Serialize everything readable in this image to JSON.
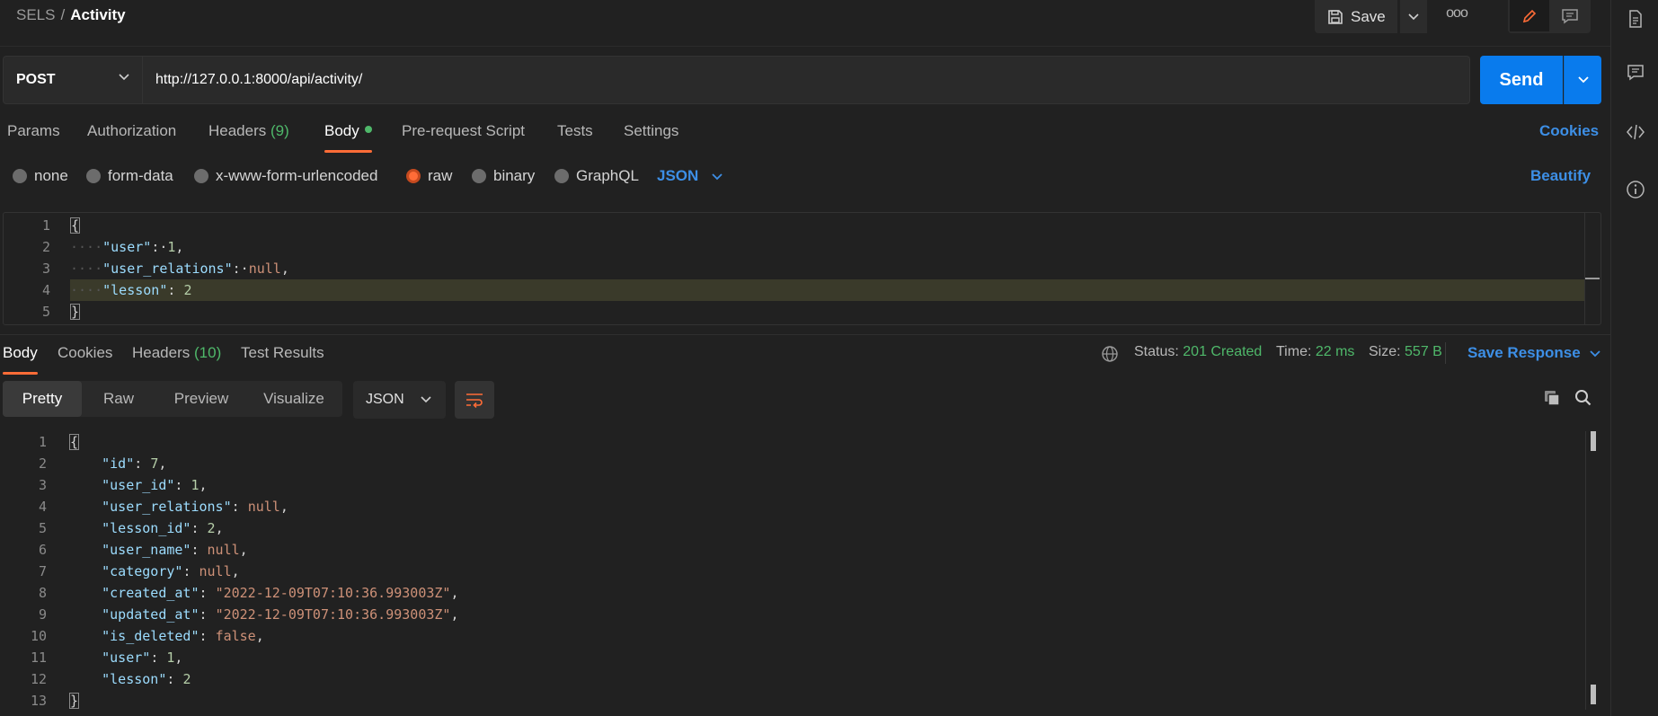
{
  "breadcrumb": {
    "collection": "SELS",
    "separator": "/",
    "request": "Activity"
  },
  "header": {
    "save_label": "Save",
    "more_label": "ooo"
  },
  "request": {
    "method": "POST",
    "url": "http://127.0.0.1:8000/api/activity/",
    "send_label": "Send"
  },
  "request_tabs": {
    "params": "Params",
    "authorization": "Authorization",
    "headers": "Headers",
    "headers_count": "(9)",
    "body": "Body",
    "prerequest": "Pre-request Script",
    "tests": "Tests",
    "settings": "Settings",
    "cookies": "Cookies"
  },
  "body_types": {
    "none": "none",
    "form_data": "form-data",
    "urlencoded": "x-www-form-urlencoded",
    "raw": "raw",
    "binary": "binary",
    "graphql": "GraphQL",
    "language": "JSON",
    "beautify": "Beautify",
    "selected": "raw"
  },
  "request_body": {
    "line_numbers": [
      "1",
      "2",
      "3",
      "4",
      "5"
    ],
    "l1": "{",
    "l2_key": "\"user\"",
    "l2_val": "1",
    "l3_key": "\"user_relations\"",
    "l3_val": "null",
    "l4_key": "\"lesson\"",
    "l4_val": "2",
    "l5": "}"
  },
  "response_tabs": {
    "body": "Body",
    "cookies": "Cookies",
    "headers": "Headers",
    "headers_count": "(10)",
    "test_results": "Test Results"
  },
  "response_status": {
    "status_label": "Status:",
    "status_value": "201 Created",
    "time_label": "Time:",
    "time_value": "22 ms",
    "size_label": "Size:",
    "size_value": "557 B",
    "save_response": "Save Response"
  },
  "response_view": {
    "pretty": "Pretty",
    "raw": "Raw",
    "preview": "Preview",
    "visualize": "Visualize",
    "format": "JSON"
  },
  "response_body": {
    "line_numbers": [
      "1",
      "2",
      "3",
      "4",
      "5",
      "6",
      "7",
      "8",
      "9",
      "10",
      "11",
      "12",
      "13"
    ],
    "l1": "{",
    "l2_key": "\"id\"",
    "l2_val": "7",
    "l3_key": "\"user_id\"",
    "l3_val": "1",
    "l4_key": "\"user_relations\"",
    "l4_val": "null",
    "l5_key": "\"lesson_id\"",
    "l5_val": "2",
    "l6_key": "\"user_name\"",
    "l6_val": "null",
    "l7_key": "\"category\"",
    "l7_val": "null",
    "l8_key": "\"created_at\"",
    "l8_val": "\"2022-12-09T07:10:36.993003Z\"",
    "l9_key": "\"updated_at\"",
    "l9_val": "\"2022-12-09T07:10:36.993003Z\"",
    "l10_key": "\"is_deleted\"",
    "l10_val": "false",
    "l11_key": "\"user\"",
    "l11_val": "1",
    "l12_key": "\"lesson\"",
    "l12_val": "2",
    "l13": "}"
  },
  "colors": {
    "accent_orange": "#ff6c37",
    "send_blue": "#097bed",
    "link_blue": "#3d8fe6",
    "success_green": "#4fb86a",
    "background": "#212121"
  },
  "icons": {
    "save": "floppy-disk-icon",
    "caret": "chevron-down-icon",
    "edit": "pencil-icon",
    "comment": "comment-icon",
    "globe": "globe-icon",
    "wrap": "wrap-lines-icon",
    "copy": "copy-icon",
    "search": "search-icon",
    "docs": "document-icon",
    "code": "code-icon",
    "info": "info-icon"
  }
}
